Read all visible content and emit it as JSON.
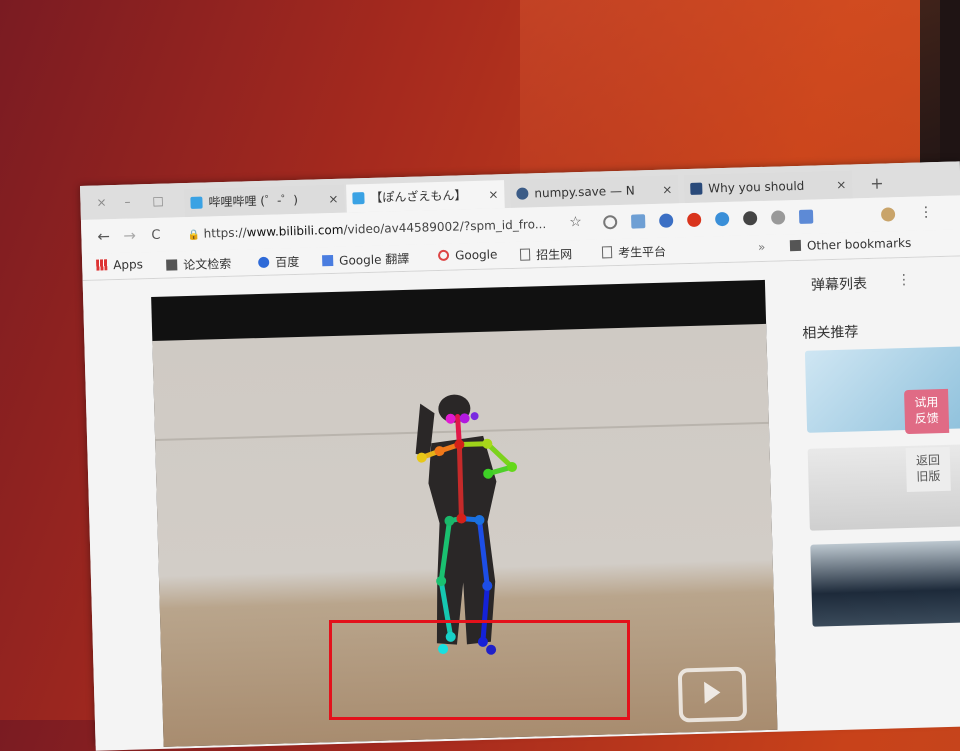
{
  "window": {
    "controls": [
      "×",
      "–",
      "□"
    ]
  },
  "tabs": [
    {
      "title": "哔哩哔哩 (゜-゜)",
      "favicon_color": "#3aa2e4",
      "active": false
    },
    {
      "title": "【ぽんざえもん】",
      "favicon_color": "#3aa2e4",
      "active": true
    },
    {
      "title": "numpy.save — N",
      "favicon_color": "#3b5b86",
      "active": false
    },
    {
      "title": "Why you should",
      "favicon_color": "#2a4a7a",
      "active": false
    }
  ],
  "tab_close": "×",
  "new_tab": "+",
  "toolbar": {
    "back": "←",
    "forward": "→",
    "reload": "C",
    "lock": "🔒",
    "url_prefix": "https://",
    "url_host": "www.bilibili.com",
    "url_path": "/video/av44589002/?spm_id_fro...",
    "star": "☆",
    "menu": "⋮"
  },
  "bookmarks": [
    {
      "label": "Apps",
      "icon": "apps-grid-icon"
    },
    {
      "label": "论文检索",
      "icon": "folder-icon"
    },
    {
      "label": "百度",
      "icon": "baidu-paw-icon"
    },
    {
      "label": "Google 翻譯",
      "icon": "translate-icon"
    },
    {
      "label": "Google",
      "icon": "google-g-icon"
    },
    {
      "label": "招生网",
      "icon": "page-icon"
    },
    {
      "label": "考生平台",
      "icon": "page-icon"
    }
  ],
  "bookmarks_overflow": "»",
  "other_bookmarks": "Other bookmarks",
  "sidebar": {
    "danmaku_title": "弹幕列表",
    "danmaku_more": "⋮",
    "related_title": "相关推荐",
    "feedback_label": "试用\n反馈",
    "feedback_line1": "试用",
    "feedback_line2": "反馈",
    "old_version_line1": "返回",
    "old_version_line2": "旧版"
  },
  "colors": {
    "annotation_box": "#e3111b",
    "feedback_bg": "#e06b85"
  }
}
